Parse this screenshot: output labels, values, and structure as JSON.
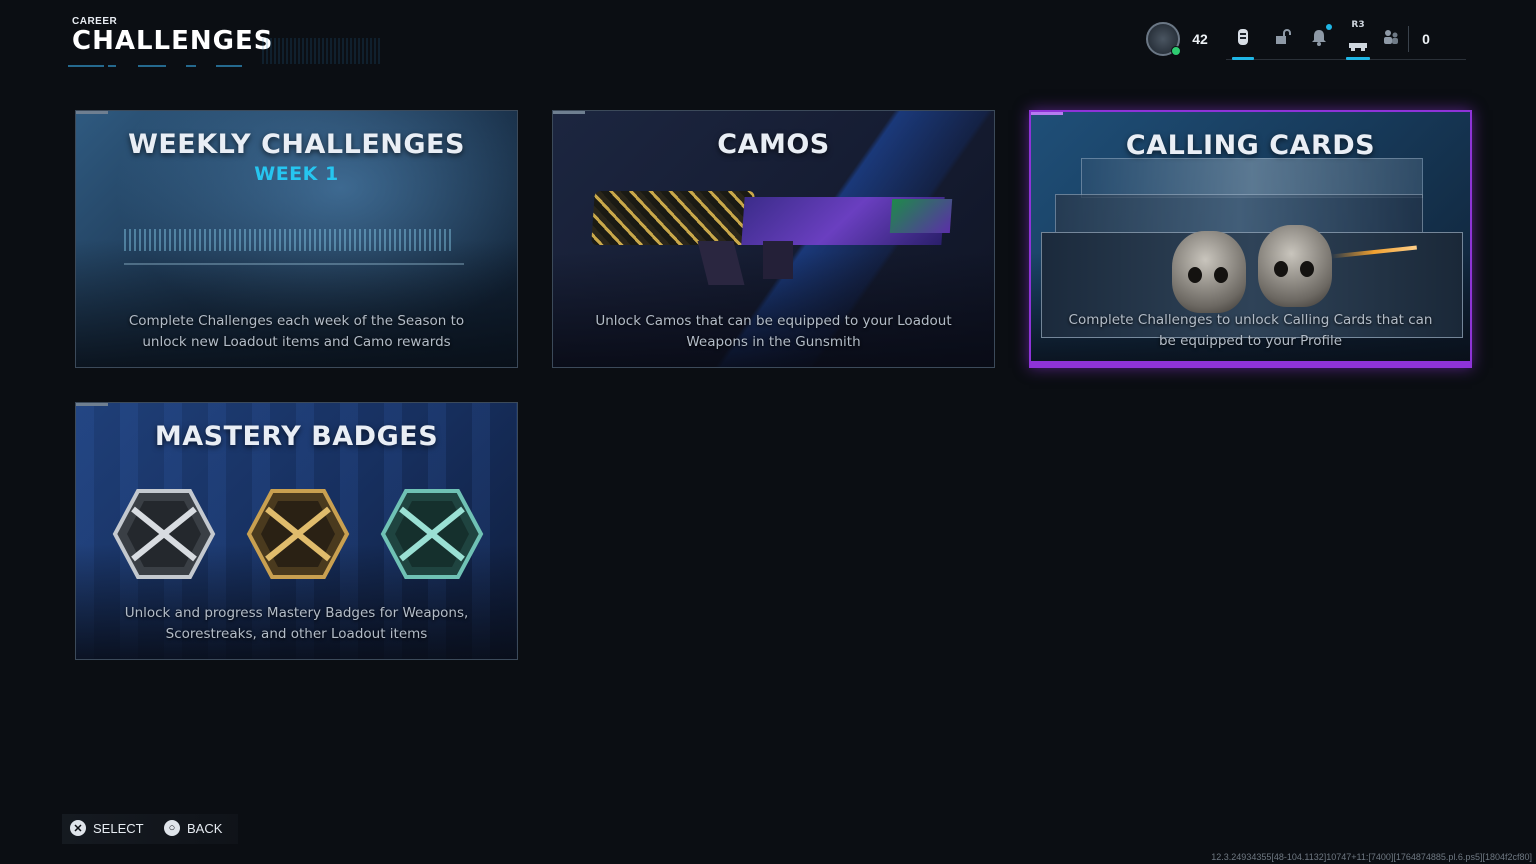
{
  "header": {
    "breadcrumb": "CAREER",
    "title": "CHALLENGES"
  },
  "topbar": {
    "player_level": "42",
    "r3_label": "R3",
    "friends_count": "0"
  },
  "cards": {
    "weekly": {
      "title": "WEEKLY CHALLENGES",
      "subtitle": "WEEK 1",
      "description": "Complete Challenges each week of the Season to unlock new Loadout items and Camo rewards"
    },
    "camos": {
      "title": "CAMOS",
      "description": "Unlock Camos that can be equipped to your Loadout Weapons in the Gunsmith"
    },
    "calling_cards": {
      "title": "CALLING CARDS",
      "description": "Complete Challenges to unlock Calling Cards that can be equipped to your Profile"
    },
    "mastery": {
      "title": "MASTERY BADGES",
      "description": "Unlock and progress Mastery Badges for Weapons, Scorestreaks, and other Loadout items"
    }
  },
  "footer": {
    "select_label": "SELECT",
    "back_label": "BACK"
  },
  "build_info": "12.3.24934355[48-104.1132]10747+11:[7400][1764874885.pl.6.ps5][1804f2cf80]",
  "colors": {
    "accent_selected": "#8e33d8",
    "accent_cyan": "#1fb6e6",
    "week_label": "#26c6f0"
  },
  "icons": [
    "prestige-icon",
    "currency-icon",
    "store-icon",
    "notification-icon",
    "social-icon",
    "friends-icon",
    "cross-button-icon",
    "circle-button-icon"
  ]
}
